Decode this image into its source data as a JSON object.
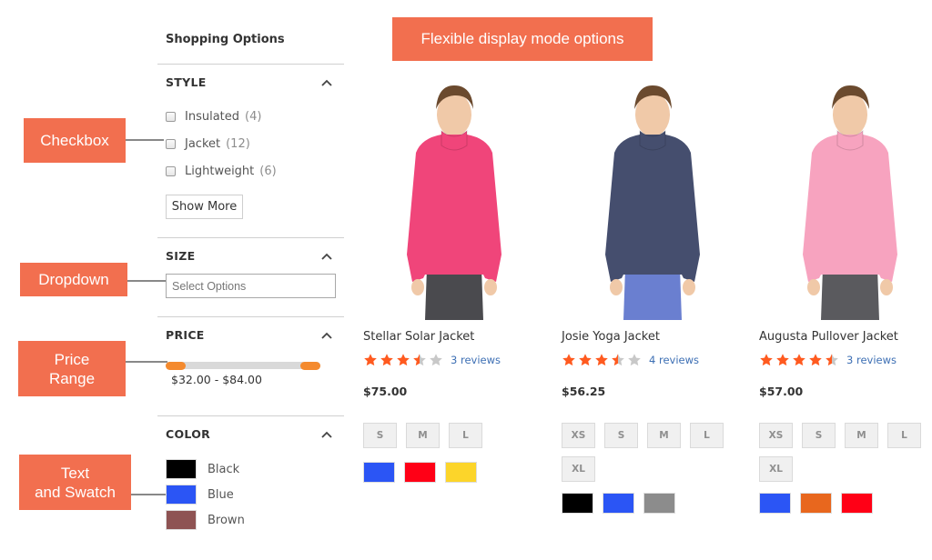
{
  "callouts": {
    "banner": "Flexible display mode options",
    "checkbox": "Checkbox",
    "dropdown": "Dropdown",
    "price_range": [
      "Price",
      "Range"
    ],
    "text_swatch": [
      "Text",
      "and Swatch"
    ]
  },
  "sidebar": {
    "title": "Shopping Options",
    "style": {
      "heading": "STYLE",
      "items": [
        {
          "label": "Insulated",
          "count": "(4)"
        },
        {
          "label": "Jacket",
          "count": "(12)"
        },
        {
          "label": "Lightweight",
          "count": "(6)"
        }
      ],
      "show_more": "Show More"
    },
    "size": {
      "heading": "SIZE",
      "placeholder": "Select Options"
    },
    "price": {
      "heading": "PRICE",
      "range_text": "$32.00 - $84.00",
      "min": 32.0,
      "max": 84.0
    },
    "color": {
      "heading": "COLOR",
      "items": [
        {
          "label": "Black",
          "hex": "#000000"
        },
        {
          "label": "Blue",
          "hex": "#2b55f5"
        },
        {
          "label": "Brown",
          "hex": "#8e5353"
        }
      ]
    }
  },
  "products": [
    {
      "name": "Stellar Solar Jacket",
      "rating": 3.5,
      "reviews": "3 reviews",
      "price": "$75.00",
      "sizes": [
        "S",
        "M",
        "L"
      ],
      "colors": [
        "#2b55f5",
        "#ff0016",
        "#fcd52a"
      ],
      "jacket_color": "#f0457a",
      "pants_color": "#4a4a4e"
    },
    {
      "name": "Josie Yoga Jacket",
      "rating": 3.5,
      "reviews": "4 reviews",
      "price": "$56.25",
      "sizes": [
        "XS",
        "S",
        "M",
        "L",
        "XL"
      ],
      "colors": [
        "#000000",
        "#2b55f5",
        "#8c8c8c"
      ],
      "jacket_color": "#454e6e",
      "pants_color": "#6a7fd0"
    },
    {
      "name": "Augusta Pullover Jacket",
      "rating": 4.5,
      "reviews": "3 reviews",
      "price": "$57.00",
      "sizes": [
        "XS",
        "S",
        "M",
        "L",
        "XL"
      ],
      "colors": [
        "#2b55f5",
        "#e8671e",
        "#ff0016"
      ],
      "jacket_color": "#f7a3bf",
      "pants_color": "#5a5a5e"
    }
  ],
  "colors": {
    "accent": "#f26f4f",
    "star_on": "#ff5a1f",
    "star_off": "#c8c8c8",
    "link": "#3d6fb4",
    "slider": "#f48a2e"
  }
}
